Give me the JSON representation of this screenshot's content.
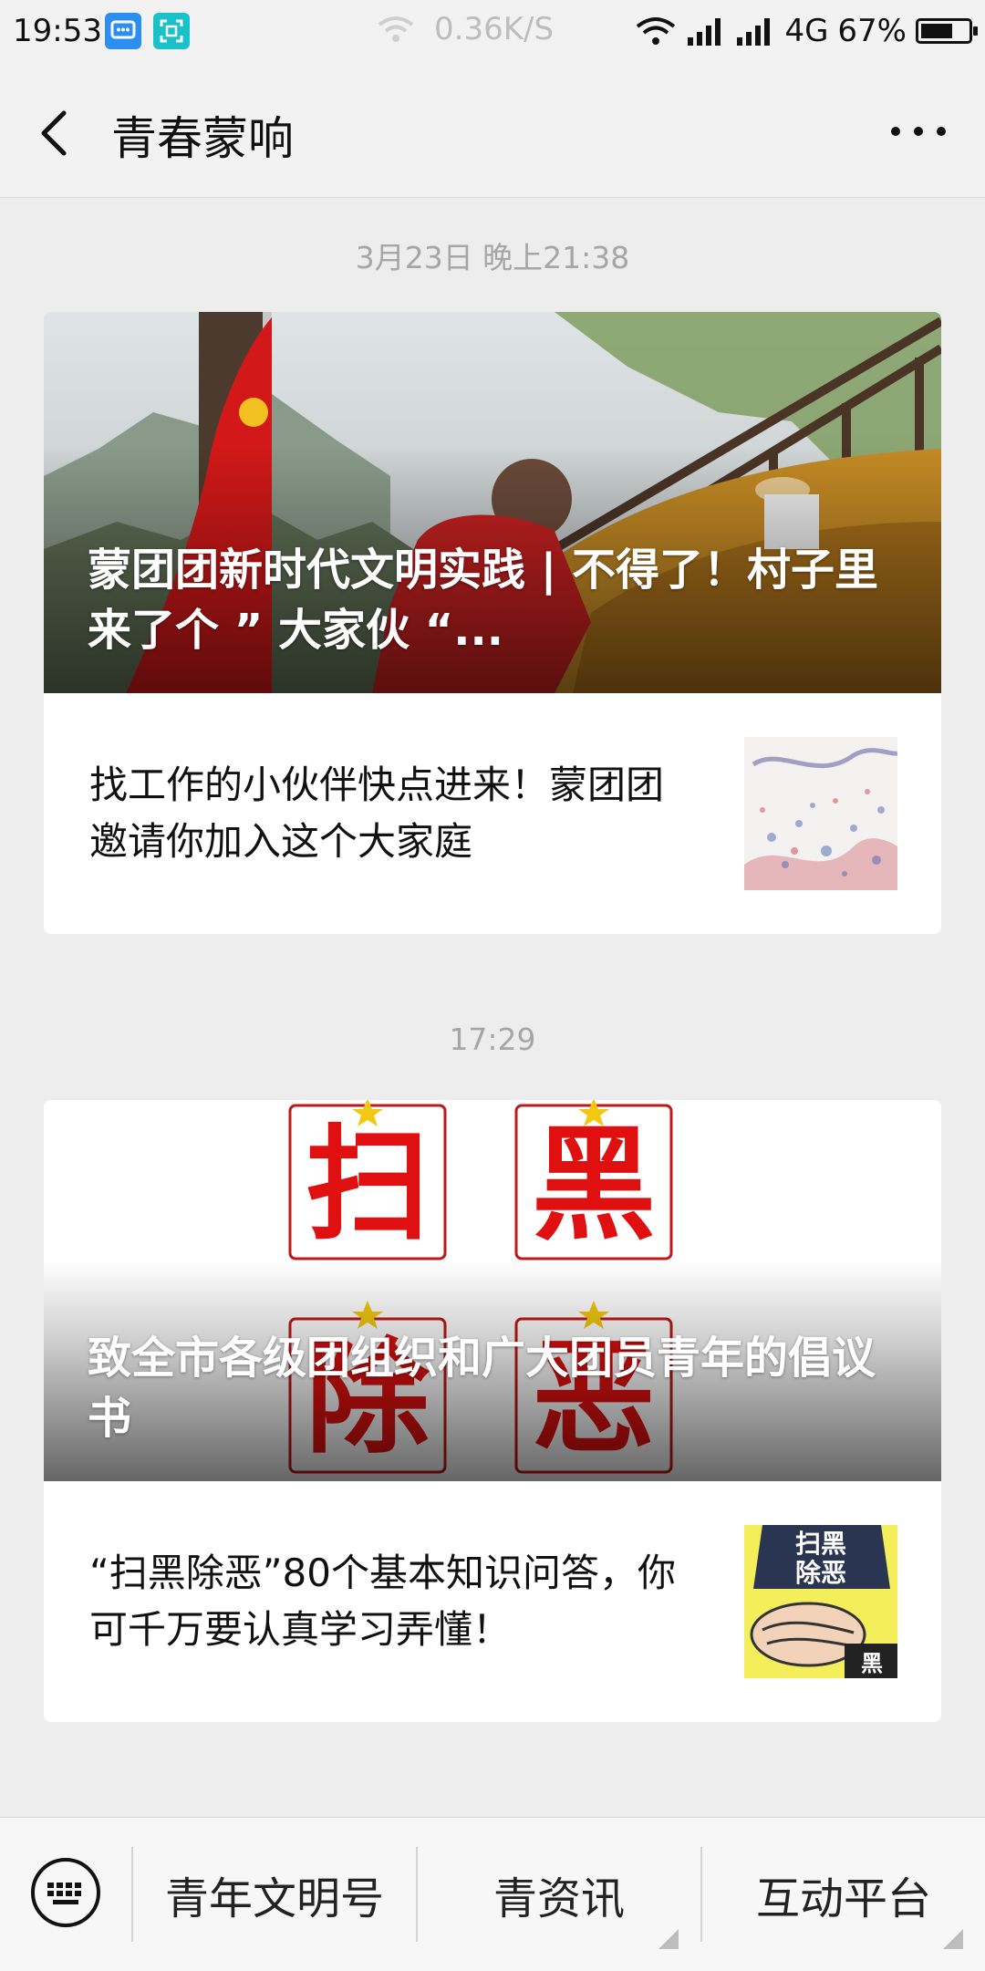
{
  "status_bar": {
    "time": "19:53",
    "net_speed": "0.36K/S",
    "network_type": "4G",
    "battery_percent": "67%",
    "battery_level": 0.67
  },
  "header": {
    "title": "青春蒙响",
    "back_icon": "back-arrow-icon",
    "more_icon": "more-dots-icon"
  },
  "messages": [
    {
      "timestamp": "3月23日 晚上21:38",
      "main_title": "蒙团团新时代文明实践 | 不得了！村子里来了个 ” 大家伙 “...",
      "sub_title": "找工作的小伙伴快点进来！蒙团团邀请你加入这个大家庭"
    },
    {
      "timestamp": "17:29",
      "main_title": "致全市各级团组织和广大团员青年的倡议书",
      "sub_title": "“扫黑除恶”80个基本知识问答，你可千万要认真学习弄懂！"
    }
  ],
  "poster_chars": [
    "扫",
    "黑",
    "除",
    "恶"
  ],
  "thumb2_chars": [
    "扫黑",
    "除恶"
  ],
  "menu": {
    "keyboard_icon": "keyboard-icon",
    "items": [
      "青年文明号",
      "青资讯",
      "互动平台"
    ]
  },
  "colors": {
    "background": "#ededed",
    "poster_red": "#e01010"
  }
}
